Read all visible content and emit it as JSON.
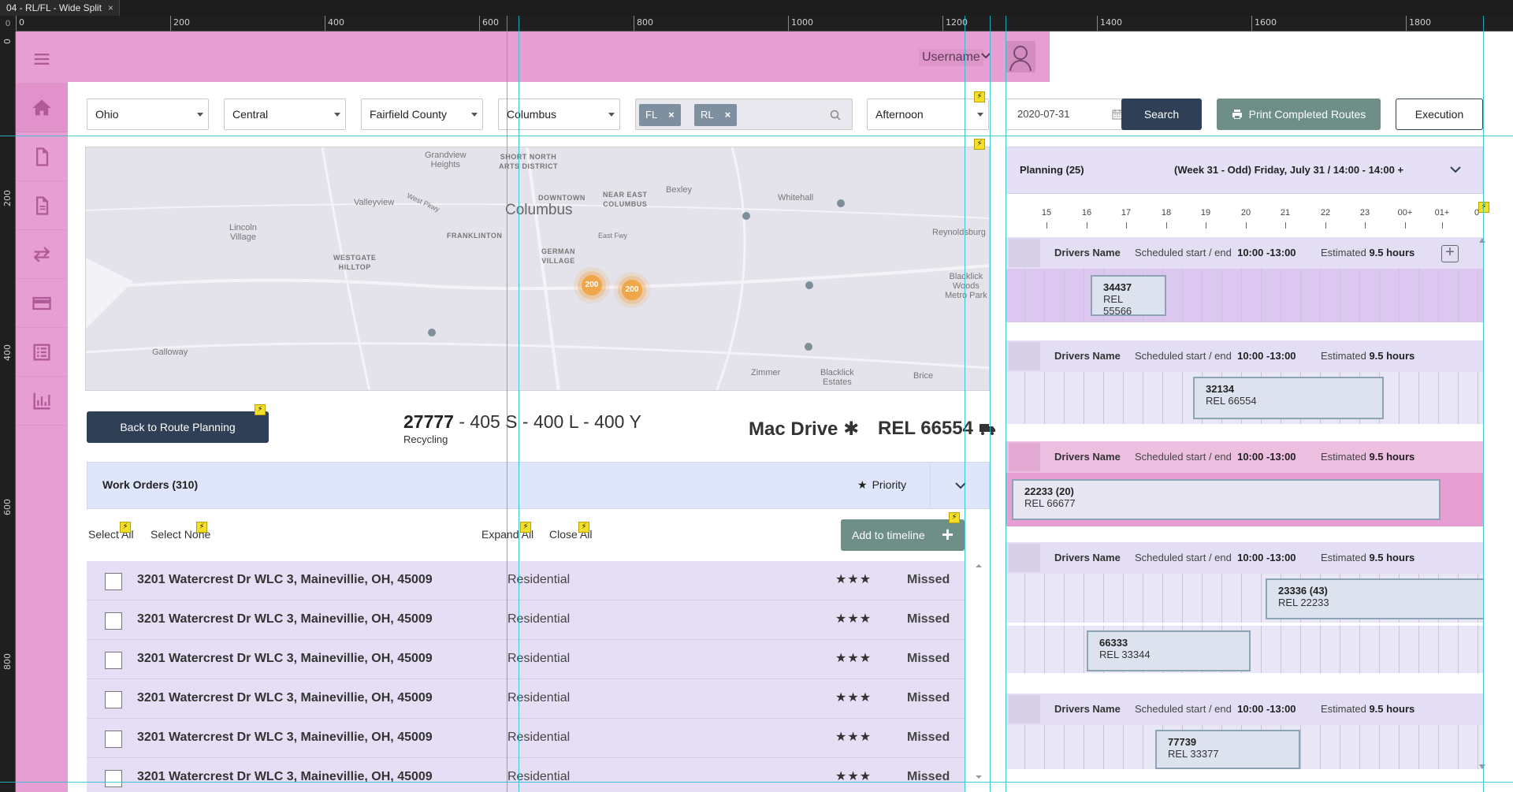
{
  "editor": {
    "tab_title": "04 - RL/FL - Wide Split",
    "tab_close": "×",
    "corner": "0",
    "ruler_top": [
      "0",
      "200",
      "400",
      "600",
      "800",
      "1000",
      "1200",
      "1400",
      "1600",
      "1800"
    ],
    "ruler_left": [
      "0",
      "200",
      "400",
      "600",
      "800"
    ]
  },
  "header": {
    "user_name": "Username"
  },
  "sidebar": {
    "items": [
      {
        "icon": "menu-icon"
      },
      {
        "icon": "home-icon"
      },
      {
        "icon": "document-icon"
      },
      {
        "icon": "report-icon"
      },
      {
        "icon": "transfer-icon"
      },
      {
        "icon": "card-icon"
      },
      {
        "icon": "list-icon"
      },
      {
        "icon": "chart-icon"
      }
    ]
  },
  "filters": {
    "state": "Ohio",
    "region": "Central",
    "county": "Fairfield County",
    "city": "Columbus",
    "tags": [
      "FL",
      "RL"
    ],
    "shift": "Afternoon",
    "date": "2020-07-31",
    "search_label": "Search",
    "print_label": "Print Completed Routes",
    "execution_label": "Execution"
  },
  "map": {
    "labels": {
      "grandview": "Grandview\nHeights",
      "short_north": "SHORT NORTH\nARTS DISTRICT",
      "valleyview": "Valleyview",
      "west_pkwy": "West Pkwy",
      "downtown": "DOWNTOWN",
      "near_east": "NEAR EAST\nCOLUMBUS",
      "bexley": "Bexley",
      "whitehall": "Whitehall",
      "columbus": "Columbus",
      "lincoln": "Lincoln\nVillage",
      "franklinton": "FRANKLINTON",
      "east_fwy": "East Fwy",
      "reynoldsburg": "Reynoldsburg",
      "westgate": "WESTGATE\nHILLTOP",
      "german": "GERMAN\nVILLAGE",
      "blacklick_woods": "Blacklick\nWoods\nMetro Park",
      "galloway": "Galloway",
      "zimmer": "Zimmer",
      "blacklick_estates": "Blacklick\nEstates",
      "brice": "Brice"
    },
    "clusters": [
      "200",
      "200"
    ]
  },
  "route": {
    "back_label": "Back to Route Planning",
    "code_bold": "27777",
    "code_rest": " - 405 S - 400 L - 400 Y",
    "type": "Recycling",
    "vehicle": "Mac Drive",
    "rel": "REL 66554"
  },
  "work_orders": {
    "title": "Work Orders (310)",
    "priority_label": "Priority",
    "select_all": "Select All",
    "select_none": "Select None",
    "expand_all": "Expand All",
    "close_all": "Close All",
    "add_label": "Add to timeline",
    "rows": [
      {
        "address": "3201 Watercrest Dr WLC 3, Mainevillie, OH, 45009",
        "type": "Residential",
        "stars": "★★★",
        "status": "Missed"
      },
      {
        "address": "3201 Watercrest Dr WLC 3, Mainevillie, OH, 45009",
        "type": "Residential",
        "stars": "★★★",
        "status": "Missed"
      },
      {
        "address": "3201 Watercrest Dr WLC 3, Mainevillie, OH, 45009",
        "type": "Residential",
        "stars": "★★★",
        "status": "Missed"
      },
      {
        "address": "3201 Watercrest Dr WLC 3, Mainevillie, OH, 45009",
        "type": "Residential",
        "stars": "★★★",
        "status": "Missed"
      },
      {
        "address": "3201 Watercrest Dr WLC 3, Mainevillie, OH, 45009",
        "type": "Residential",
        "stars": "★★★",
        "status": "Missed"
      },
      {
        "address": "3201 Watercrest Dr WLC 3, Mainevillie, OH, 45009",
        "type": "Residential",
        "stars": "★★★",
        "status": "Missed"
      }
    ]
  },
  "planning": {
    "title": "Planning (25)",
    "week": "(Week 31 - Odd) Friday, July 31 / 14:00 - 14:00 +",
    "hours": [
      "15",
      "16",
      "17",
      "18",
      "19",
      "20",
      "21",
      "22",
      "23",
      "00+",
      "01+",
      "0"
    ],
    "drivers": [
      {
        "name": "Drivers Name",
        "sched_label": "Scheduled start / end",
        "sched_value": "10:00 -13:00",
        "est_label": "Estimated",
        "est_value": "9.5 hours",
        "jobs": [
          {
            "id": "34437",
            "rel": "REL 55566"
          }
        ]
      },
      {
        "name": "Drivers Name",
        "sched_label": "Scheduled start / end",
        "sched_value": "10:00 -13:00",
        "est_label": "Estimated",
        "est_value": "9.5 hours",
        "jobs": [
          {
            "id": "32134",
            "rel": "REL 66554"
          }
        ]
      },
      {
        "name": "Drivers Name",
        "sched_label": "Scheduled start / end",
        "sched_value": "10:00 -13:00",
        "est_label": "Estimated",
        "est_value": "9.5 hours",
        "jobs": [
          {
            "id": "22233 (20)",
            "rel": "REL 66677"
          }
        ]
      },
      {
        "name": "Drivers Name",
        "sched_label": "Scheduled start / end",
        "sched_value": "10:00 -13:00",
        "est_label": "Estimated",
        "est_value": "9.5 hours",
        "jobs": [
          {
            "id": "23336 (43)",
            "rel": "REL 22233"
          },
          {
            "id": "66333",
            "rel": "REL 33344"
          }
        ]
      },
      {
        "name": "Drivers Name",
        "sched_label": "Scheduled start / end",
        "sched_value": "10:00 -13:00",
        "est_label": "Estimated",
        "est_value": "9.5 hours",
        "jobs": [
          {
            "id": "77739",
            "rel": "REL 33377"
          }
        ]
      }
    ]
  }
}
